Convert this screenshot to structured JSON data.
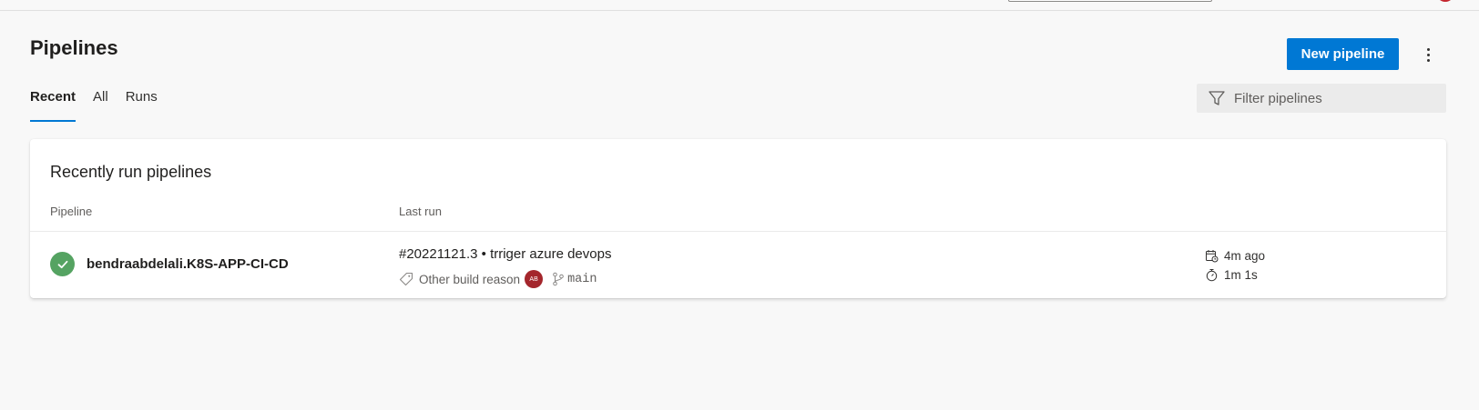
{
  "header": {
    "title": "Pipelines",
    "new_button_label": "New pipeline",
    "more_icon": "more-vertical-icon"
  },
  "tabs": [
    {
      "label": "Recent",
      "active": true
    },
    {
      "label": "All",
      "active": false
    },
    {
      "label": "Runs",
      "active": false
    }
  ],
  "filter": {
    "placeholder": "Filter pipelines",
    "icon": "filter-icon"
  },
  "recent_card": {
    "title": "Recently run pipelines",
    "columns": [
      "Pipeline",
      "Last run"
    ],
    "rows": [
      {
        "status": "succeeded",
        "pipeline_name": "bendraabdelali.K8S-APP-CI-CD",
        "run_title": "#20221121.3 • trriger azure devops",
        "reason": "Other build reason",
        "avatar_initials": "AB",
        "branch": "main",
        "started": "4m ago",
        "duration": "1m 1s"
      }
    ]
  },
  "colors": {
    "accent": "#0078d4",
    "success": "#55a362",
    "avatar": "#a4262c",
    "background": "#f8f8f8"
  }
}
